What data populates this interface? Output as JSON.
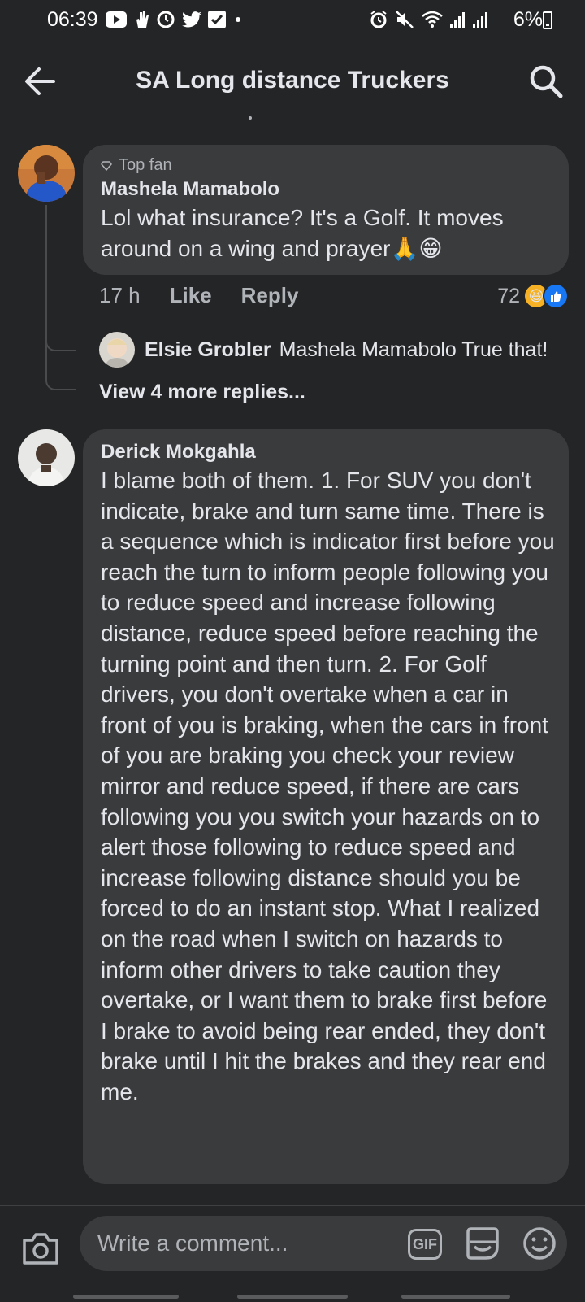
{
  "status_bar": {
    "time": "06:39",
    "battery": "6%",
    "icons_left": [
      "youtube-icon",
      "hand-icon",
      "clock-icon",
      "twitter-icon",
      "check-box-icon",
      "dot-icon"
    ],
    "icons_right": [
      "alarm-icon",
      "mute-icon",
      "wifi-icon",
      "signal-icon",
      "signal-icon-2"
    ]
  },
  "header": {
    "title": "SA Long distance Truckers",
    "back_icon": "arrow-left-icon",
    "search_icon": "search-icon"
  },
  "comments": [
    {
      "badge": "Top fan",
      "author": "Mashela Mamabolo",
      "text": "Lol what insurance? It's a Golf. It moves around on a wing and prayer🙏😁",
      "time": "17 h",
      "like_label": "Like",
      "reply_label": "Reply",
      "reaction_count": "72",
      "reply": {
        "author": "Elsie Grobler",
        "text": "Mashela Mamabolo True that!"
      },
      "more_replies": "View 4 more replies..."
    },
    {
      "author": "Derick Mokgahla",
      "text": "I blame both of them. 1. For SUV you don't indicate, brake and turn same time. There is a sequence which is indicator first before you reach the turn to inform people following you to reduce speed and increase following distance, reduce speed before reaching the turning point and then turn. 2. For Golf drivers, you don't overtake when a car in front of you is braking, when the cars in front of you are braking you check your review mirror and reduce speed, if there are cars following you you switch your hazards on to alert those following to reduce speed and increase following distance should you be forced to do an instant stop. What I realized on the road when I switch on hazards to inform other drivers to take caution they overtake, or I want them to brake first before I brake to avoid being rear ended, they don't brake until I hit the brakes and they rear end me."
    }
  ],
  "composer": {
    "placeholder": "Write a comment...",
    "gif_label": "GIF"
  },
  "colors": {
    "background": "#242526",
    "bubble": "#3a3b3c",
    "text": "#e4e6eb",
    "secondary_text": "#b0b3b8",
    "like_blue": "#1877f2",
    "haha_yellow": "#f7b125"
  }
}
